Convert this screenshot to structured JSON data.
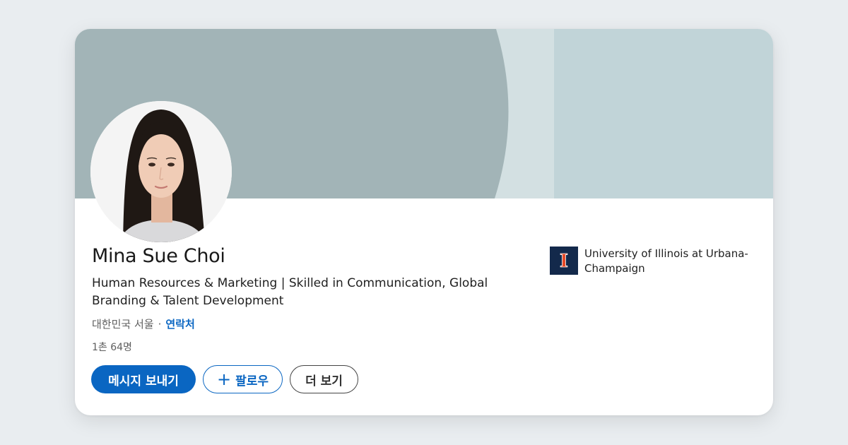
{
  "profile": {
    "name": "Mina Sue Choi",
    "headline": "Human Resources & Marketing | Skilled in Communication, Global Branding & Talent Development",
    "location": "대한민국 서울",
    "separator": "·",
    "contact_link": "연락처",
    "connections": "1촌 64명"
  },
  "actions": {
    "message_label": "메시지 보내기",
    "follow_plus": "+",
    "follow_label": "팔로우",
    "more_label": "더 보기"
  },
  "education": {
    "school_name": "University of Illinois at Urbana-Champaign",
    "logo_letter": "I"
  },
  "colors": {
    "page_background": "#e9edf0",
    "banner_dark": "#a2b4b7",
    "banner_mid": "#d3e0e2",
    "banner_light": "#c1d4d8",
    "primary_blue": "#0a66c2",
    "illinois_navy": "#13294b",
    "illinois_orange": "#e84a27"
  },
  "icons": {
    "school_logo": "illinois-block-i-icon",
    "follow": "plus-icon"
  }
}
